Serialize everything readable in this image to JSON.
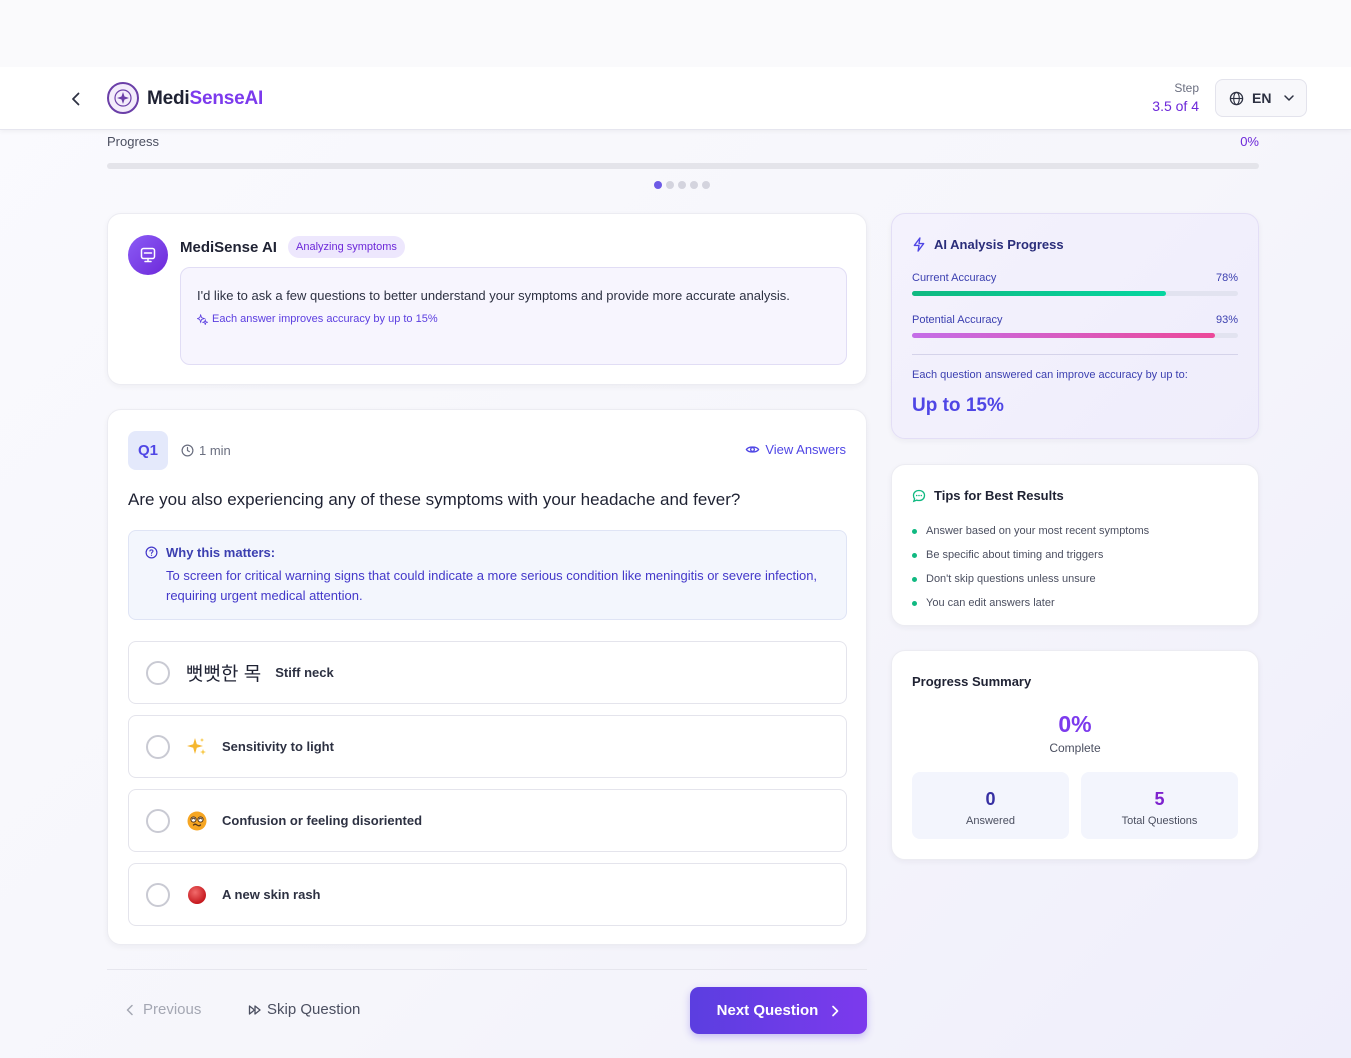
{
  "header": {
    "brand_part1": "Medi",
    "brand_part2": "SenseAI",
    "step_label": "Step",
    "step_value": "3.5 of 4",
    "language": "EN"
  },
  "progress": {
    "label": "Progress",
    "percent_text": "0%",
    "fraction": 0,
    "dots_total": 5,
    "dots_active_index": 0
  },
  "ai_message": {
    "name": "MediSense AI",
    "badge": "Analyzing symptoms",
    "message": "I'd like to ask a few questions to better understand your symptoms and provide more accurate analysis.",
    "note": "Each answer improves accuracy by up to 15%"
  },
  "question": {
    "number": "Q1",
    "time": "1 min",
    "view_answers": "View Answers",
    "text": "Are you also experiencing any of these symptoms with your headache and fever?",
    "why_title": "Why this matters:",
    "why_text": "To screen for critical warning signs that could indicate a more serious condition like meningitis or severe infection, requiring urgent medical attention.",
    "options": [
      {
        "icon_text": "뻣뻣한 목",
        "label": "Stiff neck"
      },
      {
        "icon": "sparkles-icon",
        "label": "Sensitivity to light"
      },
      {
        "icon": "dizzy-face-icon",
        "label": "Confusion or feeling disoriented"
      },
      {
        "icon": "red-circle-icon",
        "label": "A new skin rash"
      }
    ]
  },
  "footer": {
    "previous": "Previous",
    "skip": "Skip Question",
    "next": "Next Question"
  },
  "analysis": {
    "title": "AI Analysis Progress",
    "current_label": "Current Accuracy",
    "current_text": "78%",
    "current_value": 0.78,
    "potential_label": "Potential Accuracy",
    "potential_text": "93%",
    "potential_value": 0.93,
    "note": "Each question answered can improve accuracy by up to:",
    "big": "Up to 15%"
  },
  "tips": {
    "title": "Tips for Best Results",
    "items": [
      "Answer based on your most recent symptoms",
      "Be specific about timing and triggers",
      "Don't skip questions unless unsure",
      "You can edit answers later"
    ]
  },
  "summary": {
    "title": "Progress Summary",
    "percent": "0%",
    "complete_label": "Complete",
    "answered_value": "0",
    "answered_label": "Answered",
    "total_value": "5",
    "total_label": "Total Questions"
  },
  "colors": {
    "accent": "#6d28d9",
    "primary": "#5b3ee0",
    "green": "#10b981",
    "pink": "#ec4899"
  }
}
